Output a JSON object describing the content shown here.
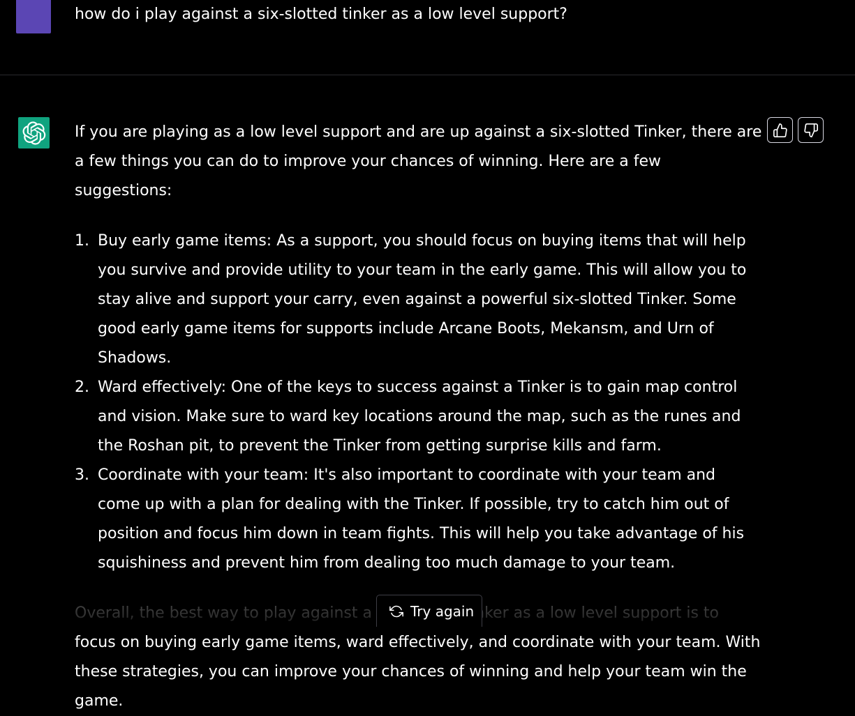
{
  "user_message": {
    "text": "how do i play against a six-slotted tinker as a low level support?",
    "avatar_color": "#5b46b4"
  },
  "assistant_message": {
    "avatar_color": "#10a37f",
    "avatar_icon": "openai-logo-icon",
    "intro": "If you are playing as a low level support and are up against a six-slotted Tinker, there are a few things you can do to improve your chances of winning. Here are a few suggestions:",
    "items": [
      {
        "number": "1.",
        "text": "Buy early game items: As a support, you should focus on buying items that will help you survive and provide utility to your team in the early game. This will allow you to stay alive and support your carry, even against a powerful six-slotted Tinker. Some good early game items for supports include Arcane Boots, Mekansm, and Urn of Shadows."
      },
      {
        "number": "2.",
        "text": "Ward effectively: One of the keys to success against a Tinker is to gain map control and vision. Make sure to ward key locations around the map, such as the runes and the Roshan pit, to prevent the Tinker from getting surprise kills and farm."
      },
      {
        "number": "3.",
        "text": "Coordinate with your team: It's also important to coordinate with your team and come up with a plan for dealing with the Tinker. If possible, try to catch him out of position and focus him down in team fights. This will help you take advantage of his squishiness and prevent him from dealing too much damage to your team."
      }
    ],
    "conclusion": "Overall, the best way to play against a six-slotted Tinker as a low level support is to focus on buying early game items, ward effectively, and coordinate with your team. With these strategies, you can improve your chances of winning and help your team win the game."
  },
  "feedback": {
    "thumbs_up_icon": "thumbs-up-icon",
    "thumbs_down_icon": "thumbs-down-icon"
  },
  "try_again": {
    "label": "Try again",
    "icon": "refresh-icon"
  }
}
